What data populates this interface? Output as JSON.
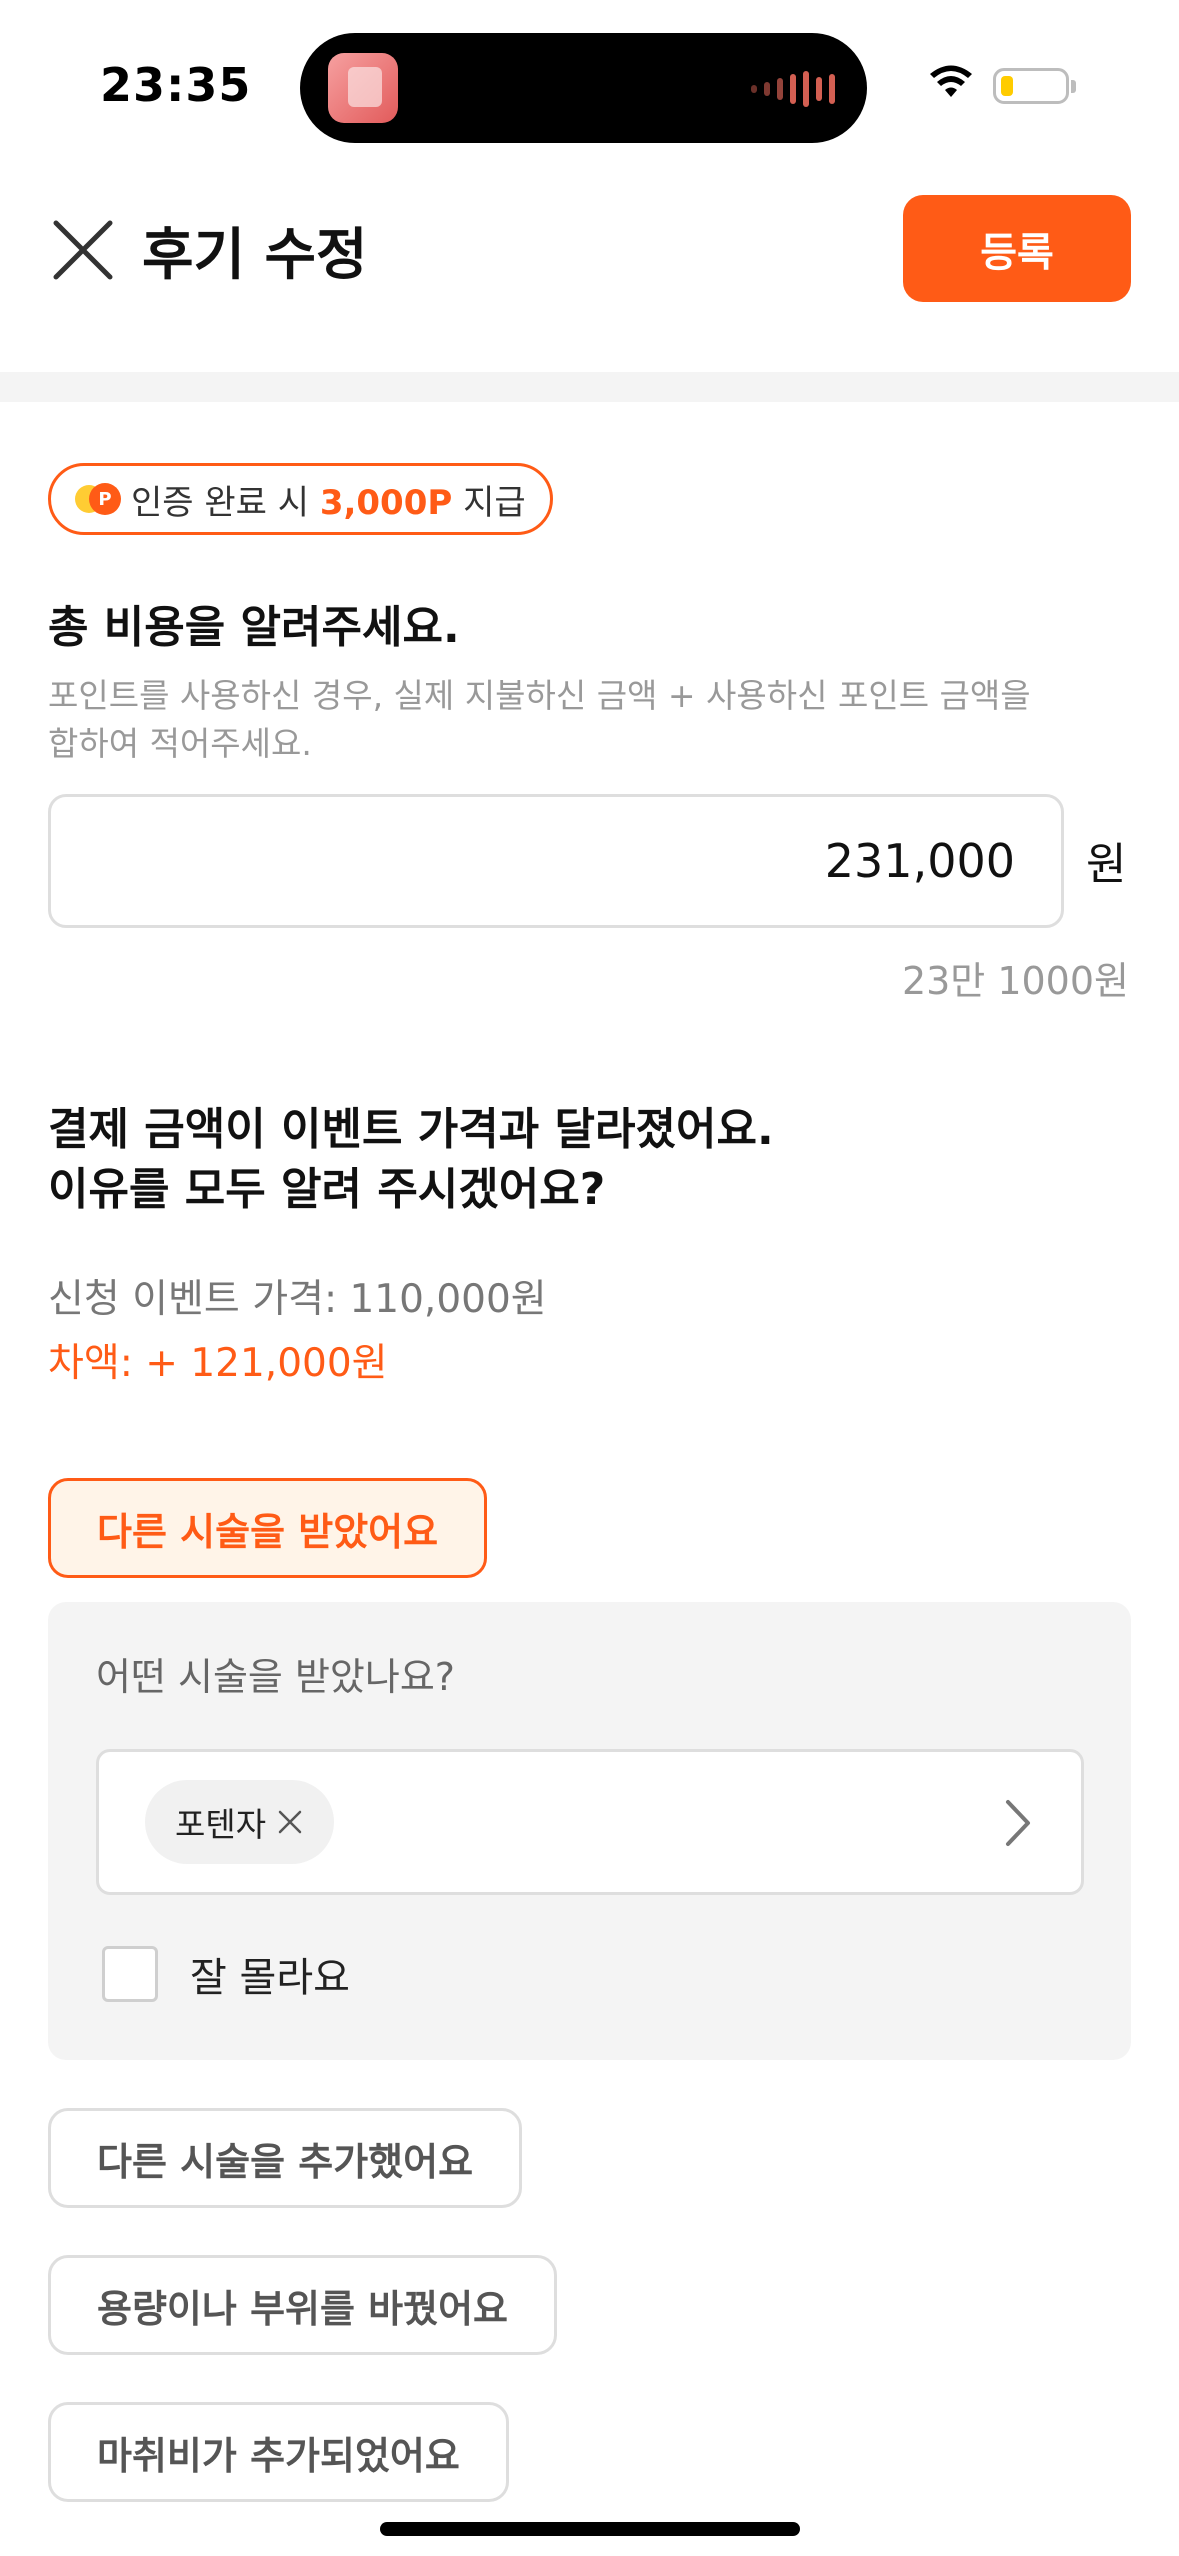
{
  "status_bar": {
    "time": "23:35"
  },
  "header": {
    "title": "후기 수정",
    "submit_label": "등록"
  },
  "point_badge": {
    "coin_letter": "P",
    "prefix": "인증 완료 시 ",
    "points": "3,000P",
    "suffix": " 지급"
  },
  "total_cost": {
    "title": "총 비용을 알려주세요.",
    "subtitle_line1": "포인트를 사용하신 경우, 실제 지불하신 금액 + 사용하신 포인트 금액을",
    "subtitle_line2": "합하여 적어주세요.",
    "amount_value": "231,000",
    "unit": "원",
    "korean_amount": "23만 1000원"
  },
  "price_diff": {
    "title_line1": "결제 금액이 이벤트 가격과 달라졌어요.",
    "title_line2": "이유를 모두 알려 주시겠어요?",
    "event_price": "신청 이벤트 가격: 110,000원",
    "difference": "차액: + 121,000원"
  },
  "reasons": {
    "selected": "다른 시술을 받았어요",
    "panel_question": "어떤 시술을 받았나요?",
    "selected_tag": "포텐자",
    "unknown_label": "잘 몰라요",
    "options": [
      "다른 시술을 추가했어요",
      "용량이나 부위를 바꿨어요",
      "마취비가 추가되었어요"
    ]
  },
  "colors": {
    "accent": "#ff5b16",
    "accent_bg": "#fff4e8",
    "panel_bg": "#f4f4f4"
  }
}
